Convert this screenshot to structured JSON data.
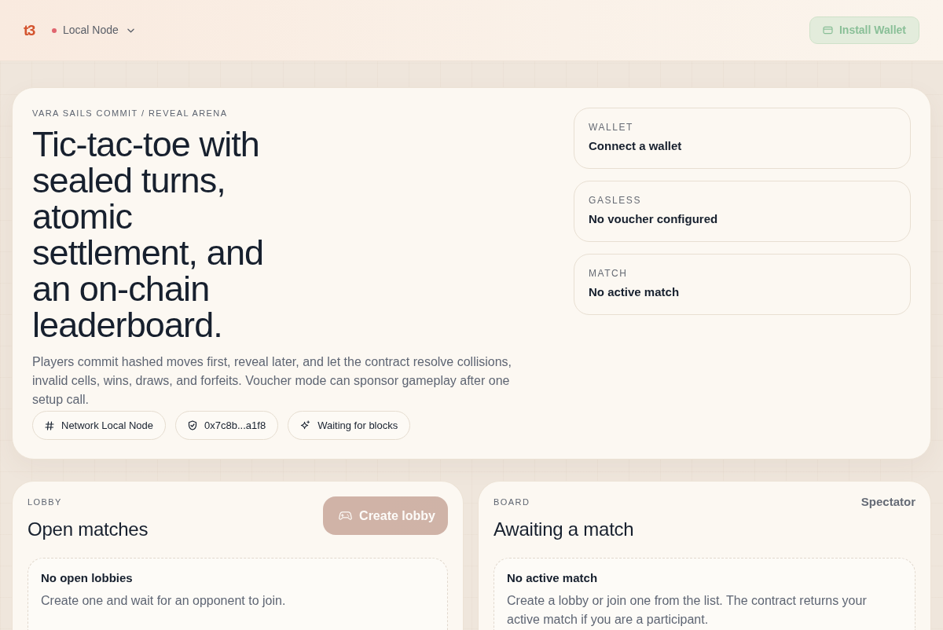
{
  "header": {
    "logo": "t3",
    "network": {
      "label": "Local Node",
      "connected": false
    },
    "install_button": {
      "label": "Install Wallet",
      "disabled": true
    }
  },
  "hero": {
    "eyebrow": "VARA SAILS COMMIT / REVEAL ARENA",
    "title": "Tic-tac-toe with sealed turns, atomic settlement, and an on-chain leaderboard.",
    "description": "Players commit hashed moves first, reveal later, and let the contract resolve collisions, invalid cells, wins, draws, and forfeits. Voucher mode can sponsor gameplay after one setup call.",
    "chips": [
      {
        "kind": "network",
        "label": "Network Local Node"
      },
      {
        "kind": "address",
        "label": "0x7c8b...a1f8"
      },
      {
        "kind": "status",
        "label": "Waiting for blocks"
      }
    ]
  },
  "status_cards": [
    {
      "label": "WALLET",
      "value": "Connect a wallet"
    },
    {
      "label": "GASLESS",
      "value": "No voucher configured"
    },
    {
      "label": "MATCH",
      "value": "No active match"
    }
  ],
  "lobby": {
    "eyebrow": "LOBBY",
    "title": "Open matches",
    "button": {
      "label": "Create lobby",
      "disabled": true
    },
    "empty": {
      "title": "No open lobbies",
      "text": "Create one and wait for an opponent to join."
    }
  },
  "board": {
    "eyebrow": "BOARD",
    "title": "Awaiting a match",
    "role": "Spectator",
    "empty": {
      "title": "No active match",
      "text": "Create a lobby or join one from the list. The contract returns your active match if you are a participant."
    }
  }
}
